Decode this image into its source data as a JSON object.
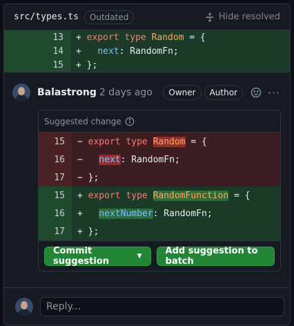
{
  "file": {
    "path": "src/types.ts",
    "badge": "Outdated",
    "hide_resolved": "Hide resolved"
  },
  "context_lines": [
    {
      "num": "13",
      "sign": "+",
      "kw": "export type",
      "name": "Random",
      "rest": " = {"
    },
    {
      "num": "14",
      "sign": "+",
      "prop": "next",
      "rest": ": RandomFn;"
    },
    {
      "num": "15",
      "sign": "+",
      "rest": "};"
    }
  ],
  "comment": {
    "author": "Balastrong",
    "time": "2 days ago",
    "roles": [
      "Owner",
      "Author"
    ],
    "avatar_icon": "user-avatar",
    "suggestion_title": "Suggested change",
    "removed": [
      {
        "num": "15",
        "sign": "−",
        "kw": "export type",
        "name": "Random",
        "rest": " = {"
      },
      {
        "num": "16",
        "sign": "−",
        "prop": "next",
        "rest": ": RandomFn;"
      },
      {
        "num": "17",
        "sign": "−",
        "rest": "};"
      }
    ],
    "added": [
      {
        "num": "15",
        "sign": "+",
        "kw": "export type",
        "name": "RandomFunction",
        "rest": " = {"
      },
      {
        "num": "16",
        "sign": "+",
        "prop": "nextNumber",
        "rest": ": RandomFn;"
      },
      {
        "num": "17",
        "sign": "+",
        "rest": "};"
      }
    ],
    "commit_label": "Commit suggestion",
    "batch_label": "Add suggestion to batch"
  },
  "reply": {
    "placeholder": "Reply..."
  },
  "colors": {
    "accent_green": "#238636",
    "deleted_bg": "#3c1e22",
    "added_bg": "#1b3a27"
  }
}
